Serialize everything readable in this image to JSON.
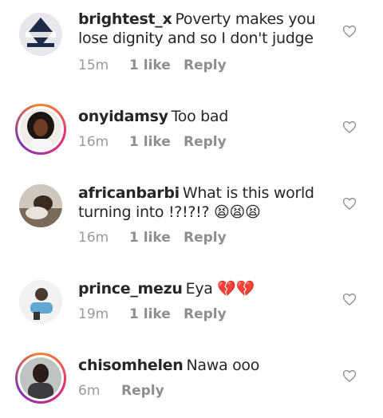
{
  "comments": [
    {
      "username": "brightest_x",
      "text": "Poverty makes you lose dignity and so I don't judge",
      "time": "15m",
      "likes": "1 like",
      "reply": "Reply",
      "avatar_icon": "emblem-avatar",
      "story_ring": false
    },
    {
      "username": "onyidamsy",
      "text": "Too bad",
      "time": "16m",
      "likes": "1 like",
      "reply": "Reply",
      "avatar_icon": "portrait-avatar",
      "story_ring": true
    },
    {
      "username": "africanbarbi",
      "text": "What is this world turning into !?!?!? 😫😫😫",
      "time": "16m",
      "likes": "1 like",
      "reply": "Reply",
      "avatar_icon": "photo-avatar",
      "story_ring": false
    },
    {
      "username": "prince_mezu",
      "text": "Eya 💔💔",
      "time": "19m",
      "likes": "1 like",
      "reply": "Reply",
      "avatar_icon": "cartoon-avatar",
      "story_ring": false
    },
    {
      "username": "chisomhelen",
      "text": "Nawa ooo",
      "time": "6m",
      "likes": "",
      "reply": "Reply",
      "avatar_icon": "portrait-avatar",
      "story_ring": true
    }
  ],
  "colors": {
    "text": "#262626",
    "meta": "#8e8e8e",
    "ring_start": "#f58529",
    "ring_mid": "#dd2a7b",
    "ring_end": "#8134af"
  }
}
